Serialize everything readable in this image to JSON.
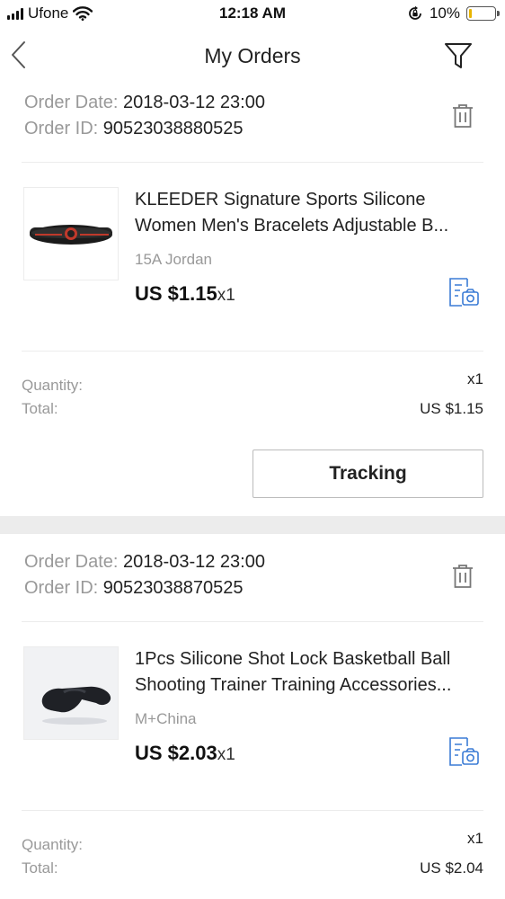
{
  "status_bar": {
    "carrier": "Ufone",
    "time": "12:18 AM",
    "battery": "10%",
    "battery_level": 0.1
  },
  "nav": {
    "title": "My Orders"
  },
  "orders": [
    {
      "order_date_label": "Order Date: ",
      "order_date": "2018-03-12 23:00",
      "order_id_label": "Order ID: ",
      "order_id": "90523038880525",
      "product": {
        "title_line1": "KLEEDER Signature Sports Silicone",
        "title_line2": "Women Men's Bracelets Adjustable B...",
        "variant": "15A Jordan",
        "price": "US $1.15",
        "qty": "x1"
      },
      "quantity_label": "Quantity:",
      "quantity_value": "x1",
      "total_label": "Total:",
      "total_value": "US $1.15",
      "tracking_label": "Tracking"
    },
    {
      "order_date_label": "Order Date: ",
      "order_date": "2018-03-12 23:00",
      "order_id_label": "Order ID: ",
      "order_id": "90523038870525",
      "product": {
        "title_line1": "1Pcs Silicone Shot Lock Basketball Ball",
        "title_line2": "Shooting Trainer Training Accessories...",
        "variant": "M+China",
        "price": "US $2.03",
        "qty": "x1"
      },
      "quantity_label": "Quantity:",
      "quantity_value": "x1",
      "total_label": "Total:",
      "total_value": "US $2.04"
    }
  ],
  "colors": {
    "accent_blue": "#3a7bd5",
    "muted_text": "#999999",
    "section_gap": "#ececec"
  }
}
